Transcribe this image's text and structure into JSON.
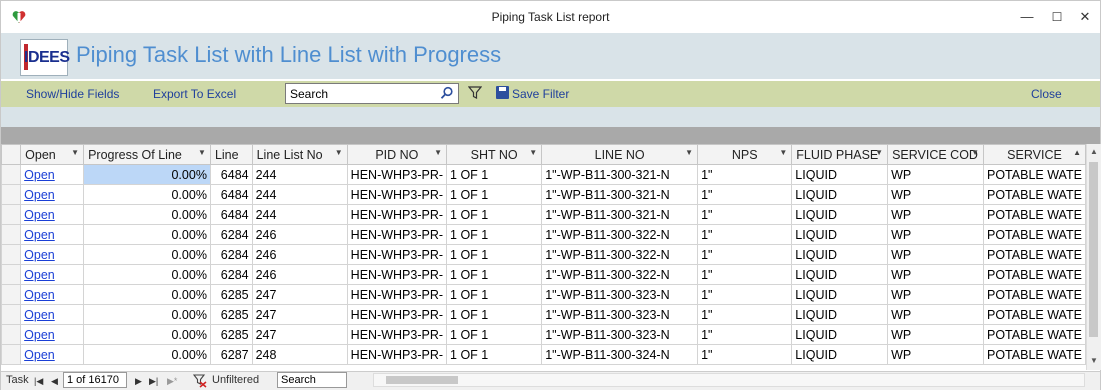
{
  "window": {
    "title": "Piping Task List report",
    "controls": {
      "minimize": "—",
      "maximize": "☐",
      "close": "✕"
    }
  },
  "header": {
    "logo_text": "IDEES",
    "page_title": "Piping Task List with Line List with Progress"
  },
  "toolbar": {
    "show_hide_label": "Show/Hide Fields",
    "export_label": "Export To Excel",
    "search_value": "Search",
    "save_filter_label": "Save Filter",
    "close_label": "Close"
  },
  "grid": {
    "columns": [
      "Open",
      "Progress Of Line",
      "Line",
      "Line List No",
      "PID NO",
      "SHT NO",
      "LINE NO",
      "NPS",
      "FLUID PHASE",
      "SERVICE COD",
      "SERVICE"
    ],
    "rows": [
      {
        "open": "Open",
        "progress": "0.00%",
        "line": "6484",
        "line_list_no": "244",
        "pid_no": "HEN-WHP3-PR-",
        "sht_no": "1 OF 1",
        "line_no": "1\"-WP-B11-300-321-N",
        "nps": "1\"",
        "fluid_phase": "LIQUID",
        "service_code": "WP",
        "service": "POTABLE WATE"
      },
      {
        "open": "Open",
        "progress": "0.00%",
        "line": "6484",
        "line_list_no": "244",
        "pid_no": "HEN-WHP3-PR-",
        "sht_no": "1 OF 1",
        "line_no": "1\"-WP-B11-300-321-N",
        "nps": "1\"",
        "fluid_phase": "LIQUID",
        "service_code": "WP",
        "service": "POTABLE WATE"
      },
      {
        "open": "Open",
        "progress": "0.00%",
        "line": "6484",
        "line_list_no": "244",
        "pid_no": "HEN-WHP3-PR-",
        "sht_no": "1 OF 1",
        "line_no": "1\"-WP-B11-300-321-N",
        "nps": "1\"",
        "fluid_phase": "LIQUID",
        "service_code": "WP",
        "service": "POTABLE WATE"
      },
      {
        "open": "Open",
        "progress": "0.00%",
        "line": "6284",
        "line_list_no": "246",
        "pid_no": "HEN-WHP3-PR-",
        "sht_no": "1 OF 1",
        "line_no": "1\"-WP-B11-300-322-N",
        "nps": "1\"",
        "fluid_phase": "LIQUID",
        "service_code": "WP",
        "service": "POTABLE WATE"
      },
      {
        "open": "Open",
        "progress": "0.00%",
        "line": "6284",
        "line_list_no": "246",
        "pid_no": "HEN-WHP3-PR-",
        "sht_no": "1 OF 1",
        "line_no": "1\"-WP-B11-300-322-N",
        "nps": "1\"",
        "fluid_phase": "LIQUID",
        "service_code": "WP",
        "service": "POTABLE WATE"
      },
      {
        "open": "Open",
        "progress": "0.00%",
        "line": "6284",
        "line_list_no": "246",
        "pid_no": "HEN-WHP3-PR-",
        "sht_no": "1 OF 1",
        "line_no": "1\"-WP-B11-300-322-N",
        "nps": "1\"",
        "fluid_phase": "LIQUID",
        "service_code": "WP",
        "service": "POTABLE WATE"
      },
      {
        "open": "Open",
        "progress": "0.00%",
        "line": "6285",
        "line_list_no": "247",
        "pid_no": "HEN-WHP3-PR-",
        "sht_no": "1 OF 1",
        "line_no": "1\"-WP-B11-300-323-N",
        "nps": "1\"",
        "fluid_phase": "LIQUID",
        "service_code": "WP",
        "service": "POTABLE WATE"
      },
      {
        "open": "Open",
        "progress": "0.00%",
        "line": "6285",
        "line_list_no": "247",
        "pid_no": "HEN-WHP3-PR-",
        "sht_no": "1 OF 1",
        "line_no": "1\"-WP-B11-300-323-N",
        "nps": "1\"",
        "fluid_phase": "LIQUID",
        "service_code": "WP",
        "service": "POTABLE WATE"
      },
      {
        "open": "Open",
        "progress": "0.00%",
        "line": "6285",
        "line_list_no": "247",
        "pid_no": "HEN-WHP3-PR-",
        "sht_no": "1 OF 1",
        "line_no": "1\"-WP-B11-300-323-N",
        "nps": "1\"",
        "fluid_phase": "LIQUID",
        "service_code": "WP",
        "service": "POTABLE WATE"
      },
      {
        "open": "Open",
        "progress": "0.00%",
        "line": "6287",
        "line_list_no": "248",
        "pid_no": "HEN-WHP3-PR-",
        "sht_no": "1 OF 1",
        "line_no": "1\"-WP-B11-300-324-N",
        "nps": "1\"",
        "fluid_phase": "LIQUID",
        "service_code": "WP",
        "service": "POTABLE WATE"
      }
    ]
  },
  "navigation": {
    "label": "Task",
    "record": "1 of 16170",
    "filter_status": "Unfiltered",
    "search_value": "Search"
  },
  "colors": {
    "header_bg": "#d9e3e8",
    "toolbar_bg": "#cfd9a8",
    "title_blue": "#4f8ed0",
    "link_blue": "#1f3f9c",
    "selected_cell": "#bcd7f7"
  }
}
